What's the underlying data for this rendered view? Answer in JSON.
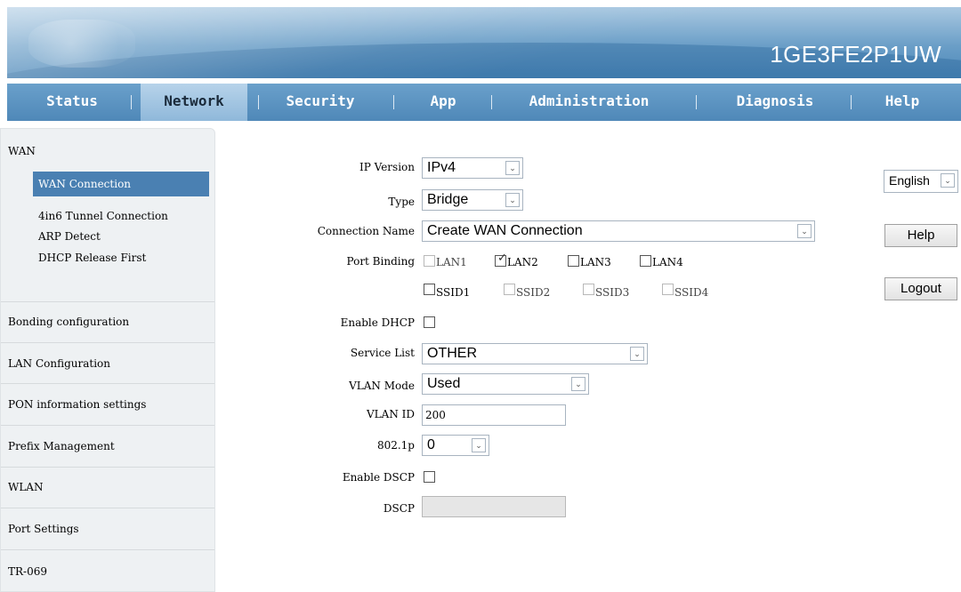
{
  "header": {
    "model": "1GE3FE2P1UW"
  },
  "nav": {
    "items": [
      "Status",
      "Network",
      "Security",
      "App",
      "Administration",
      "Diagnosis",
      "Help"
    ],
    "active": "Network"
  },
  "sidebar": {
    "section_wan": "WAN",
    "wan_items": [
      "WAN Connection",
      "4in6 Tunnel Connection",
      "ARP Detect",
      "DHCP Release First"
    ],
    "items": [
      "Bonding configuration",
      "LAN Configuration",
      "PON information settings",
      "Prefix Management",
      "WLAN",
      "Port Settings",
      "TR-069"
    ]
  },
  "form": {
    "ip_version": {
      "label": "IP Version",
      "value": "IPv4"
    },
    "type": {
      "label": "Type",
      "value": "Bridge"
    },
    "connection_name": {
      "label": "Connection Name",
      "value": "Create WAN Connection"
    },
    "port_binding": {
      "label": "Port Binding",
      "lan": [
        {
          "name": "LAN1",
          "checked": false
        },
        {
          "name": "LAN2",
          "checked": true
        },
        {
          "name": "LAN3",
          "checked": false
        },
        {
          "name": "LAN4",
          "checked": false
        }
      ],
      "ssid": [
        {
          "name": "SSID1",
          "checked": false
        },
        {
          "name": "SSID2",
          "checked": false
        },
        {
          "name": "SSID3",
          "checked": false
        },
        {
          "name": "SSID4",
          "checked": false
        }
      ]
    },
    "enable_dhcp": {
      "label": "Enable DHCP"
    },
    "service_list": {
      "label": "Service List",
      "value": "OTHER"
    },
    "vlan_mode": {
      "label": "VLAN Mode",
      "value": "Used"
    },
    "vlan_id": {
      "label": "VLAN ID",
      "value": "200"
    },
    "dot1p": {
      "label": "802.1p",
      "value": "0"
    },
    "enable_dscp": {
      "label": "Enable DSCP"
    },
    "dscp": {
      "label": "DSCP",
      "value": ""
    }
  },
  "right": {
    "language": "English",
    "help_label": "Help",
    "logout_label": "Logout"
  },
  "icons": {
    "dropdown": "chevron-down-icon",
    "check": "checkmark-icon"
  }
}
